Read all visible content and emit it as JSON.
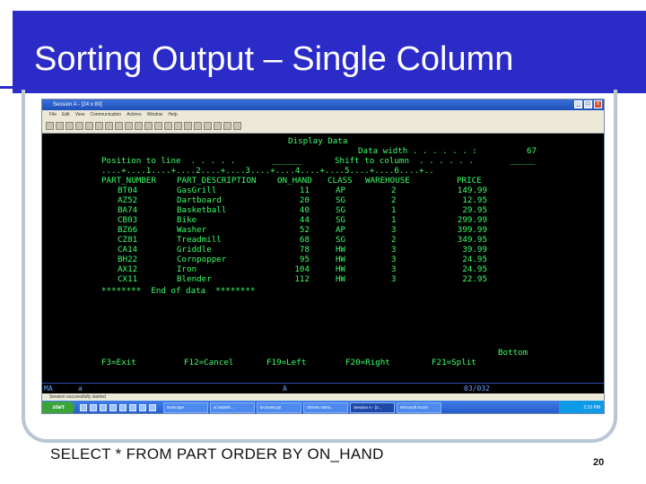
{
  "slide": {
    "title": "Sorting Output – Single Column",
    "caption": "SELECT * FROM PART ORDER BY ON_HAND",
    "page_number": "20",
    "colors": {
      "title_bar": "#2b2bc8",
      "terminal_text": "#3aff6a",
      "terminal_bg": "#000000"
    }
  },
  "window": {
    "title": "Session A - [24 x 80]",
    "menu": [
      "File",
      "Edit",
      "View",
      "Communication",
      "Actions",
      "Window",
      "Help"
    ],
    "controls": [
      "_",
      "□",
      "x"
    ]
  },
  "terminal": {
    "header": "Display Data",
    "data_width_label": "Data width . . . . . . :",
    "data_width_value": "67",
    "position_label": "Position to line  . . . . .",
    "position_value": "______",
    "shift_label": "Shift to column  . . . . . .",
    "shift_value": "_____",
    "ruler": "....+....1....+....2....+....3....+....4....+....5....+....6....+..",
    "columns": [
      "PART_NUMBER",
      "PART_DESCRIPTION",
      "ON_HAND",
      "CLASS",
      "WAREHOUSE",
      "PRICE"
    ],
    "rows": [
      [
        "BT04",
        "GasGrill",
        "11",
        "AP",
        "2",
        "149.99"
      ],
      [
        "AZ52",
        "Dartboard",
        "20",
        "SG",
        "2",
        "12.95"
      ],
      [
        "BA74",
        "Basketball",
        "40",
        "SG",
        "1",
        "29.95"
      ],
      [
        "CB03",
        "Bike",
        "44",
        "SG",
        "1",
        "299.99"
      ],
      [
        "BZ66",
        "Washer",
        "52",
        "AP",
        "3",
        "399.99"
      ],
      [
        "CZ81",
        "Treadmill",
        "68",
        "SG",
        "2",
        "349.95"
      ],
      [
        "CA14",
        "Griddle",
        "78",
        "HW",
        "3",
        "39.99"
      ],
      [
        "BH22",
        "Cornpopper",
        "95",
        "HW",
        "3",
        "24.95"
      ],
      [
        "AX12",
        "Iron",
        "104",
        "HW",
        "3",
        "24.95"
      ],
      [
        "CX11",
        "Blender",
        "112",
        "HW",
        "3",
        "22.95"
      ]
    ],
    "end_marker": "********  End of data  ********",
    "bottom_label": "Bottom",
    "function_keys": [
      "F3=Exit",
      "F12=Cancel",
      "F19=Left",
      "F20=Right",
      "F21=Split"
    ],
    "status": {
      "left": "MA",
      "mode": "a",
      "insert": "A",
      "cursor": "03/032"
    }
  },
  "session_bar": "Session successfully started",
  "taskbar": {
    "start": "start",
    "tasks": [
      "Netscape",
      "w:\\slide\\fi...",
      "lecture6.ppt",
      "Shrnes Nami...",
      "Session A - [2...",
      "Microsoft Excel"
    ],
    "active_task": 4,
    "clock": "2:10 PM"
  }
}
